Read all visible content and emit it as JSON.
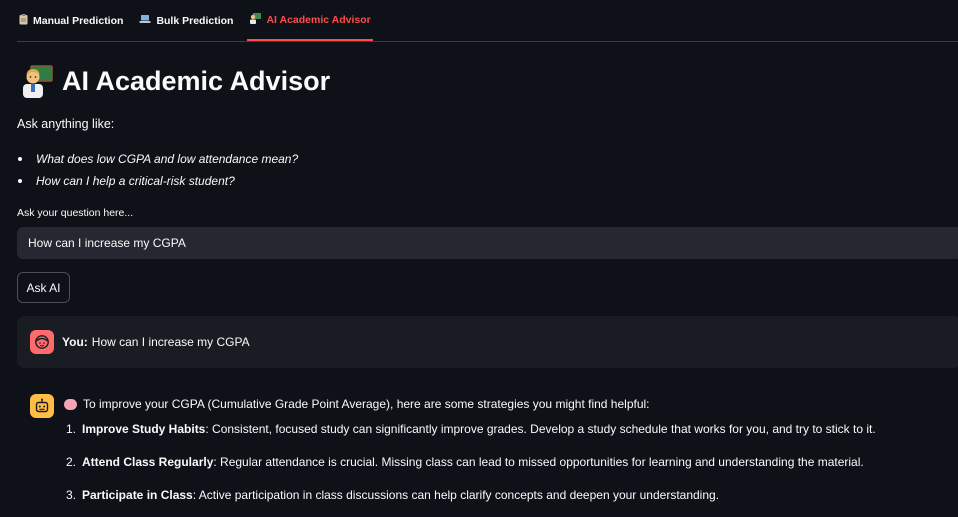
{
  "tabs": [
    {
      "label": "Manual Prediction",
      "icon": "clipboard-icon",
      "active": false
    },
    {
      "label": "Bulk Prediction",
      "icon": "laptop-icon",
      "active": false
    },
    {
      "label": "AI Academic Advisor",
      "icon": "teacher-icon",
      "active": true
    }
  ],
  "page": {
    "title": "AI Academic Advisor",
    "title_icon": "teacher-emoji",
    "intro": "Ask anything like:",
    "examples": [
      "What does low CGPA and low attendance mean?",
      "How can I help a critical-risk student?"
    ]
  },
  "question": {
    "label": "Ask your question here...",
    "value": "How can I increase my CGPA"
  },
  "ask_button": {
    "label": "Ask AI"
  },
  "chat": {
    "user": {
      "prefix": "You:",
      "text": "How can I increase my CGPA",
      "avatar_color": "#ff6b6b"
    },
    "assistant": {
      "avatar_color": "#ffbd45",
      "intro": "To improve your CGPA (Cumulative Grade Point Average), here are some strategies you might find helpful:",
      "tips": [
        {
          "num": "1.",
          "title": "Improve Study Habits",
          "text": ": Consistent, focused study can significantly improve grades. Develop a study schedule that works for you, and try to stick to it."
        },
        {
          "num": "2.",
          "title": "Attend Class Regularly",
          "text": ": Regular attendance is crucial. Missing class can lead to missed opportunities for learning and understanding the material."
        },
        {
          "num": "3.",
          "title": "Participate in Class",
          "text": ": Active participation in class discussions can help clarify concepts and deepen your understanding."
        }
      ]
    }
  },
  "colors": {
    "background": "#0e1117",
    "accent": "#ff4b4b",
    "input_bg": "#262730"
  }
}
